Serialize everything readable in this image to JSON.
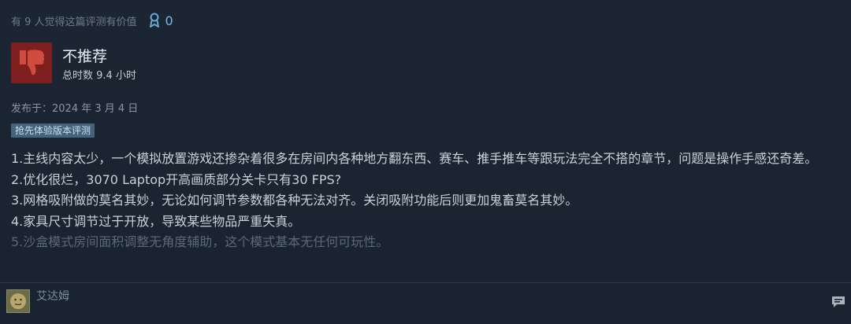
{
  "helpful": {
    "text": "有 9 人觉得这篇评测有价值",
    "award_count": "0"
  },
  "verdict": {
    "title": "不推荐",
    "hours": "总时数 9.4 小时"
  },
  "posted": "发布于：2024 年 3 月 4 日",
  "tag": "抢先体验版本评测",
  "review_lines": [
    "1.主线内容太少，一个模拟放置游戏还掺杂着很多在房间内各种地方翻东西、赛车、推手推车等跟玩法完全不搭的章节，问题是操作手感还奇差。",
    "2.优化很烂，3070 Laptop开高画质部分关卡只有30 FPS?",
    "3.网格吸附做的莫名其妙，无论如何调节参数都各种无法对齐。关闭吸附功能后则更加鬼畜莫名其妙。",
    "4.家具尺寸调节过于开放，导致某些物品严重失真。",
    "5.沙盒模式房间面积调整无角度辅助，这个模式基本无任何可玩性。"
  ],
  "commenter": {
    "name": "艾达姆"
  },
  "colors": {
    "background": "#1b2430",
    "thumb_down_bg": "#7e1f1f",
    "tag_bg": "#46637c",
    "award_blue": "#65a9d8"
  },
  "icons": [
    "award-icon",
    "thumbs-down-icon",
    "avatar-face-icon",
    "comment-icon"
  ]
}
